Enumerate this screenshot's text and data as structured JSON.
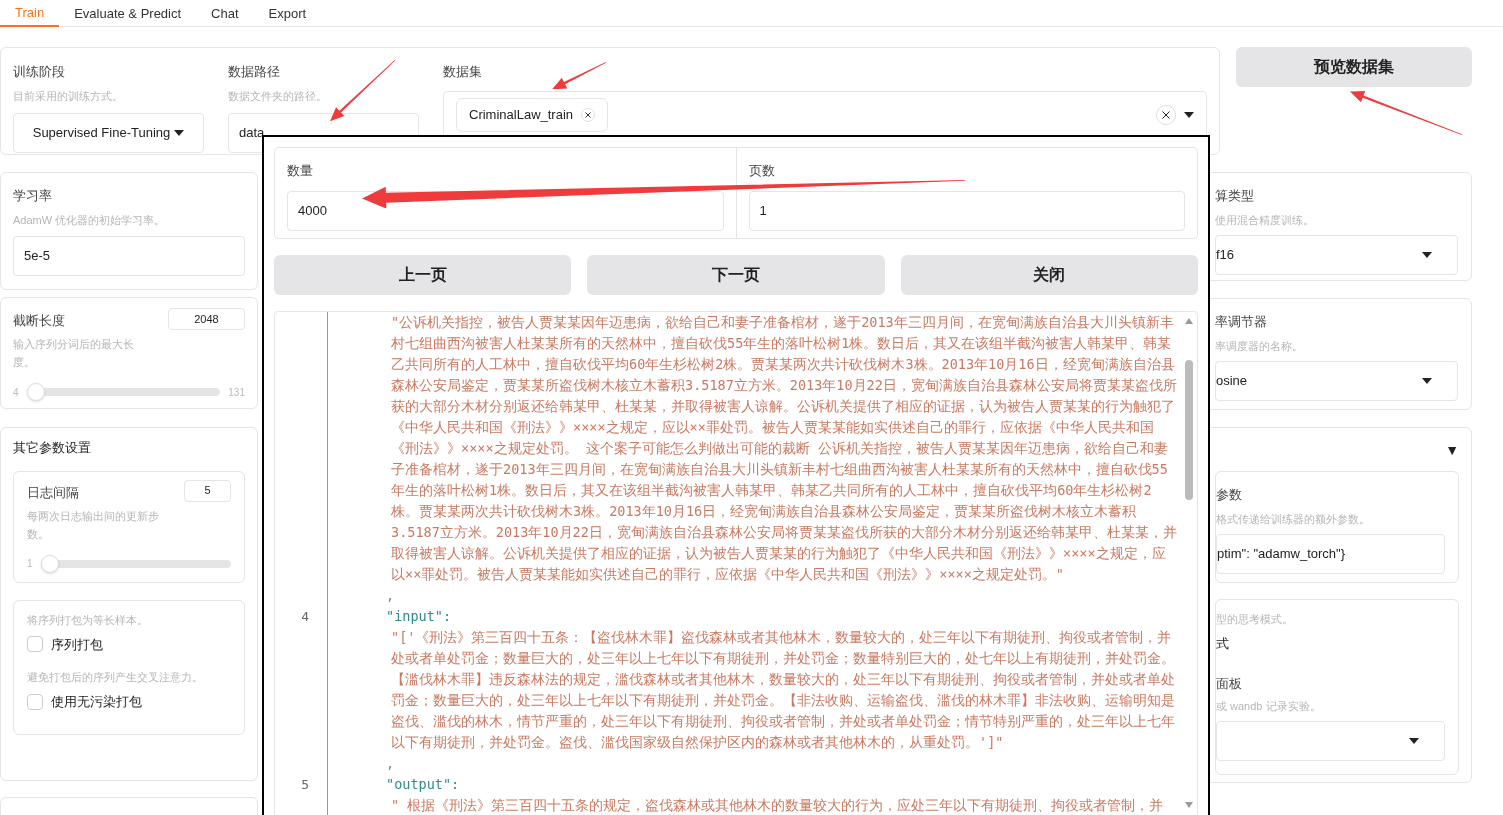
{
  "tabs": [
    {
      "label": "Train",
      "selected": true
    },
    {
      "label": "Evaluate & Predict",
      "selected": false
    },
    {
      "label": "Chat",
      "selected": false
    },
    {
      "label": "Export",
      "selected": false
    }
  ],
  "top": {
    "stage": {
      "label": "训练阶段",
      "hint": "目前采用的训练方式。",
      "value": "Supervised Fine-Tuning"
    },
    "data_dir": {
      "label": "数据路径",
      "hint": "数据文件夹的路径。",
      "value": "data"
    },
    "dataset": {
      "label": "数据集",
      "tags": [
        "CriminalLaw_train"
      ]
    },
    "preview_button": "预览数据集"
  },
  "left": {
    "learning_rate": {
      "label": "学习率",
      "hint": "AdamW 优化器的初始学习率。",
      "value": "5e-5"
    },
    "cutoff": {
      "label": "截断长度",
      "hint": "输入序列分词后的最大长度。",
      "value": "2048",
      "min": "4",
      "max": "131",
      "level": 0
    },
    "other": {
      "title": "其它参数设置",
      "logging": {
        "label": "日志间隔",
        "hint": "每两次日志输出间的更新步数。",
        "value": "5",
        "min": "1",
        "level": 0
      },
      "options": [
        {
          "hint": "将序列打包为等长样本。",
          "label": "序列打包",
          "checked": false
        },
        {
          "hint": "避免打包后的序列产生交叉注意力。",
          "label": "使用无污染打包",
          "checked": false
        }
      ]
    }
  },
  "right": {
    "compute": {
      "label": "算类型",
      "hint": "使用混合精度训练。",
      "value": "f16"
    },
    "scheduler": {
      "label": "率调节器",
      "hint": "率调度器的名称。",
      "value": "osine"
    },
    "extra": {
      "toggle": "▼",
      "expanded": true,
      "args": {
        "label": "参数",
        "hint": "格式传递给训练器的额外参数。",
        "value": "ptim\": \"adamw_torch\"}"
      },
      "thinking": {
        "hint": "型的思考模式。",
        "label": "式"
      },
      "report": {
        "label": "面板",
        "hint": "或 wandb 记录实验。"
      }
    }
  },
  "modal": {
    "count": {
      "label": "数量",
      "value": "4000"
    },
    "page": {
      "label": "页数",
      "value": "1"
    },
    "buttons": [
      "上一页",
      "下一页",
      "关闭"
    ],
    "lines": [
      {
        "kind": "string",
        "text": "\"公诉机关指控，被告人贾某某因年迈患病，欲给自己和妻子准备棺材，遂于2013年三四月间，在宽甸满族自治县大川头镇新丰村七组曲西沟被害人杜某某所有的天然林中，擅自砍伐55年生的落叶松树1株。数日后，其又在该组半截沟被害人韩某甲、韩某乙共同所有的人工林中，擅自砍伐平均60年生杉松树2株。贾某某两次共计砍伐树木3株。2013年10月16日，经宽甸满族自治县森林公安局鉴定，贾某某所盗伐树木核立木蓄积3.5187立方米。2013年10月22日，宽甸满族自治县森林公安局将贾某某盗伐所获的大部分木材分别返还给韩某甲、杜某某，并取得被害人谅解。公诉机关提供了相应的证据，认为被告人贾某某的行为触犯了《中华人民共和国《刑法》》××××之规定，应以××罪处罚。被告人贾某某能如实供述自己的罪行，应依据《中华人民共和国《刑法》》××××之规定处罚。 这个案子可能怎么判做出可能的裁断 公诉机关指控，被告人贾某某因年迈患病，欲给自己和妻子准备棺材，遂于2013年三四月间，在宽甸满族自治县大川头镇新丰村七组曲西沟被害人杜某某所有的天然林中，擅自砍伐55年生的落叶松树1株。数日后，其又在该组半截沟被害人韩某甲、韩某乙共同所有的人工林中，擅自砍伐平均60年生杉松树2株。贾某某两次共计砍伐树木3株。2013年10月16日，经宽甸满族自治县森林公安局鉴定，贾某某所盗伐树木核立木蓄积3.5187立方米。2013年10月22日，宽甸满族自治县森林公安局将贾某某盗伐所获的大部分木材分别返还给韩某甲、杜某某，并取得被害人谅解。公诉机关提供了相应的证据，认为被告人贾某某的行为触犯了《中华人民共和国《刑法》》××××之规定，应以××罪处罚。被告人贾某某能如实供述自己的罪行，应依据《中华人民共和国《刑法》》××××之规定处罚。\""
      },
      {
        "kind": "punct",
        "text": ","
      },
      {
        "kind": "key",
        "number": "4",
        "text": "\"input\":"
      },
      {
        "kind": "string",
        "text": "\"['《刑法》第三百四十五条：【盗伐林木罪】盗伐森林或者其他林木，数量较大的，处三年以下有期徒刑、拘役或者管制，并处或者单处罚金；数量巨大的，处三年以上七年以下有期徒刑，并处罚金；数量特别巨大的，处七年以上有期徒刑，并处罚金。【滥伐林木罪】违反森林法的规定，滥伐森林或者其他林木，数量较大的，处三年以下有期徒刑、拘役或者管制，并处或者单处罚金；数量巨大的，处三年以上七年以下有期徒刑，并处罚金。【非法收购、运输盗伐、滥伐的林木罪】非法收购、运输明知是盗伐、滥伐的林木，情节严重的，处三年以下有期徒刑、拘役或者管制，并处或者单处罚金；情节特别严重的，处三年以上七年以下有期徒刑，并处罚金。盗伐、滥伐国家级自然保护区内的森林或者其他林木的，从重处罚。']\""
      },
      {
        "kind": "punct",
        "text": ","
      },
      {
        "kind": "key",
        "number": "5",
        "text": "\"output\":"
      },
      {
        "kind": "string",
        "text": "\" 根据《刑法》第三百四十五条的规定，盗伐森林或其他林木的数量较大的行为，应处三年以下有期徒刑、拘役或者管制，并"
      }
    ]
  }
}
